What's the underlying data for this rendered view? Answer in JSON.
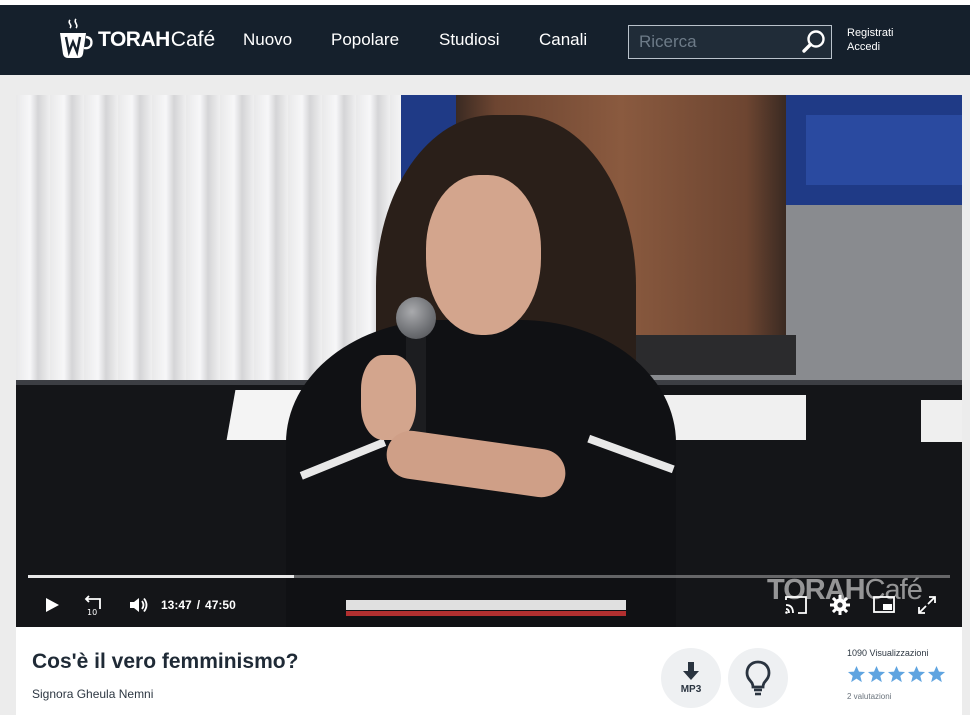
{
  "header": {
    "logo": {
      "torah": "TORAH",
      "cafe": "Café"
    },
    "nav": [
      {
        "label": "Nuovo"
      },
      {
        "label": "Popolare"
      },
      {
        "label": "Studiosi"
      },
      {
        "label": "Canali"
      }
    ],
    "search": {
      "placeholder": "Ricerca",
      "value": ""
    },
    "auth": {
      "register": "Registrati",
      "login": "Accedi"
    }
  },
  "player": {
    "current_time": "13:47",
    "separator": "/",
    "duration": "47:50",
    "progress_fraction": 0.288,
    "skip_back_seconds": "10",
    "watermark": {
      "torah": "TORAH",
      "cafe": "Café"
    }
  },
  "video_info": {
    "title": "Cos'è il vero femminismo?",
    "author": "Signora Gheula Nemni",
    "mp3_label": "MP3",
    "views": "1090 Visualizzazioni",
    "rating": 5,
    "rating_max": 5,
    "ratings_count": "2 valutazioni"
  },
  "colors": {
    "navbar": "#15202c",
    "star": "#5fa4e0",
    "title": "#1f2a36"
  }
}
